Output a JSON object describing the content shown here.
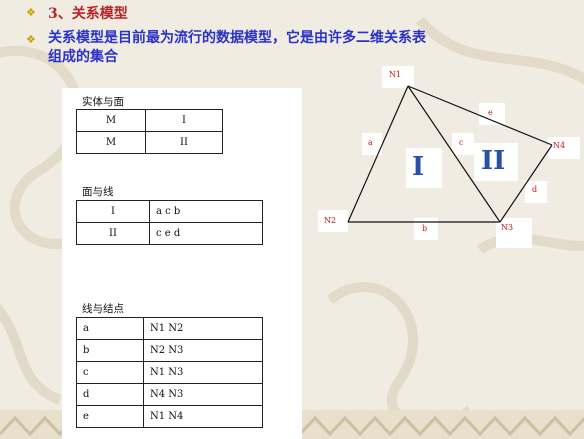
{
  "heading": {
    "bullet": "❖",
    "text": "3、关系模型"
  },
  "description": {
    "bullet": "❖",
    "line1": "关系模型是目前最为流行的数据模型，它是由许多二维关系表",
    "line2": "组成的集合"
  },
  "tables": {
    "solid_face": {
      "label": "实体与面",
      "rows": [
        [
          "M",
          "I"
        ],
        [
          "M",
          "II"
        ]
      ]
    },
    "face_line": {
      "label": "面与线",
      "rows": [
        [
          "I",
          "a    c    b"
        ],
        [
          "II",
          "c    e    d"
        ]
      ]
    },
    "line_node": {
      "label": "线与结点",
      "rows": [
        [
          "a",
          "N1    N2"
        ],
        [
          "b",
          "N2    N3"
        ],
        [
          "c",
          "N1    N3"
        ],
        [
          "d",
          "N4    N3"
        ],
        [
          "e",
          "N1    N4"
        ]
      ]
    }
  },
  "diagram": {
    "nodes": {
      "n1": "N1",
      "n2": "N2",
      "n3": "N3",
      "n4": "N4"
    },
    "edges": {
      "a": "a",
      "b": "b",
      "c": "c",
      "d": "d",
      "e": "e"
    },
    "regions": {
      "r1": "I",
      "r2": "II"
    },
    "colors": {
      "line": "#111111",
      "label": "#c01a1a",
      "region": "#2850a8"
    }
  },
  "colors": {
    "title": "#b8242a",
    "body": "#2a32c8",
    "bullet": "#c8a200"
  }
}
